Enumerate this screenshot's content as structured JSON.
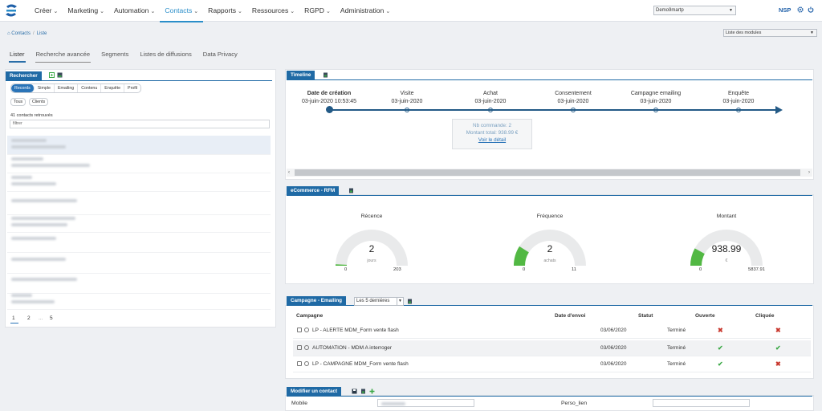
{
  "nav": {
    "items": [
      {
        "label": "Créer"
      },
      {
        "label": "Marketing"
      },
      {
        "label": "Automation"
      },
      {
        "label": "Contacts"
      },
      {
        "label": "Rapports"
      },
      {
        "label": "Ressources"
      },
      {
        "label": "RGPD"
      },
      {
        "label": "Administration"
      }
    ],
    "active": "Contacts",
    "env_select": "Demo9martp",
    "user": "NSP"
  },
  "breadcrumb": {
    "root": "Contacts",
    "current": "Liste"
  },
  "module_select": "Liste des modules",
  "tabs": [
    {
      "label": "Lister"
    },
    {
      "label": "Recherche avancée"
    },
    {
      "label": "Segments"
    },
    {
      "label": "Listes de diffusions"
    },
    {
      "label": "Data Privacy"
    }
  ],
  "search": {
    "title": "Rechercher",
    "types": [
      "Records",
      "Simple",
      "Emailing",
      "Contenu",
      "Enquête",
      "Profil"
    ],
    "filters": [
      "Tous",
      "Clients"
    ],
    "found": "41 contacts retrouvés",
    "filter_placeholder": "filtrer",
    "pages": [
      "1",
      "2",
      "...",
      "5"
    ]
  },
  "timeline": {
    "title": "Timeline",
    "events": [
      {
        "label": "Date de création",
        "date": "03-juin-2020 10:53:45"
      },
      {
        "label": "Visite",
        "date": "03-juin-2020"
      },
      {
        "label": "Achat",
        "date": "03-juin-2020"
      },
      {
        "label": "Consentement",
        "date": "03-juin-2020"
      },
      {
        "label": "Campagne emailing",
        "date": "03-juin-2020"
      },
      {
        "label": "Enquête",
        "date": "03-juin-2020"
      }
    ],
    "detail": {
      "line1": "Nb commande: 2",
      "line2": "Montant total: 938.99 €",
      "link": "Voir le détail"
    }
  },
  "rfm": {
    "title": "eCommerce - RFM",
    "gauges": [
      {
        "title": "Récence",
        "value": "2",
        "unit": "jours",
        "min": "0",
        "max": "203",
        "fraction": 0.01
      },
      {
        "title": "Fréquence",
        "value": "2",
        "unit": "achats",
        "min": "0",
        "max": "11",
        "fraction": 0.18
      },
      {
        "title": "Montant",
        "value": "938.99",
        "unit": "€",
        "min": "0",
        "max": "5837.91",
        "fraction": 0.16
      }
    ]
  },
  "campaign": {
    "title": "Campagne - Emailing",
    "select": "Les 5 dernières",
    "headers": [
      "Campagne",
      "Date d'envoi",
      "Statut",
      "Ouverte",
      "Cliquée"
    ],
    "rows": [
      {
        "name": "LP - ALERTE MDM_Form vente flash",
        "date": "03/06/2020",
        "status": "Terminé",
        "opened": false,
        "clicked": false
      },
      {
        "name": "AUTOMATION - MDM A interroger",
        "date": "03/06/2020",
        "status": "Terminé",
        "opened": true,
        "clicked": true
      },
      {
        "name": "LP - CAMPAGNE MDM_Form vente flash",
        "date": "03/06/2020",
        "status": "Terminé",
        "opened": true,
        "clicked": false
      }
    ]
  },
  "modify": {
    "title": "Modifier un contact",
    "fields": [
      "Mobile",
      "Perso_lien"
    ]
  },
  "colors": {
    "brand": "#1f6aa5",
    "accent": "#2a8ec9",
    "gauge": "#52b843"
  }
}
